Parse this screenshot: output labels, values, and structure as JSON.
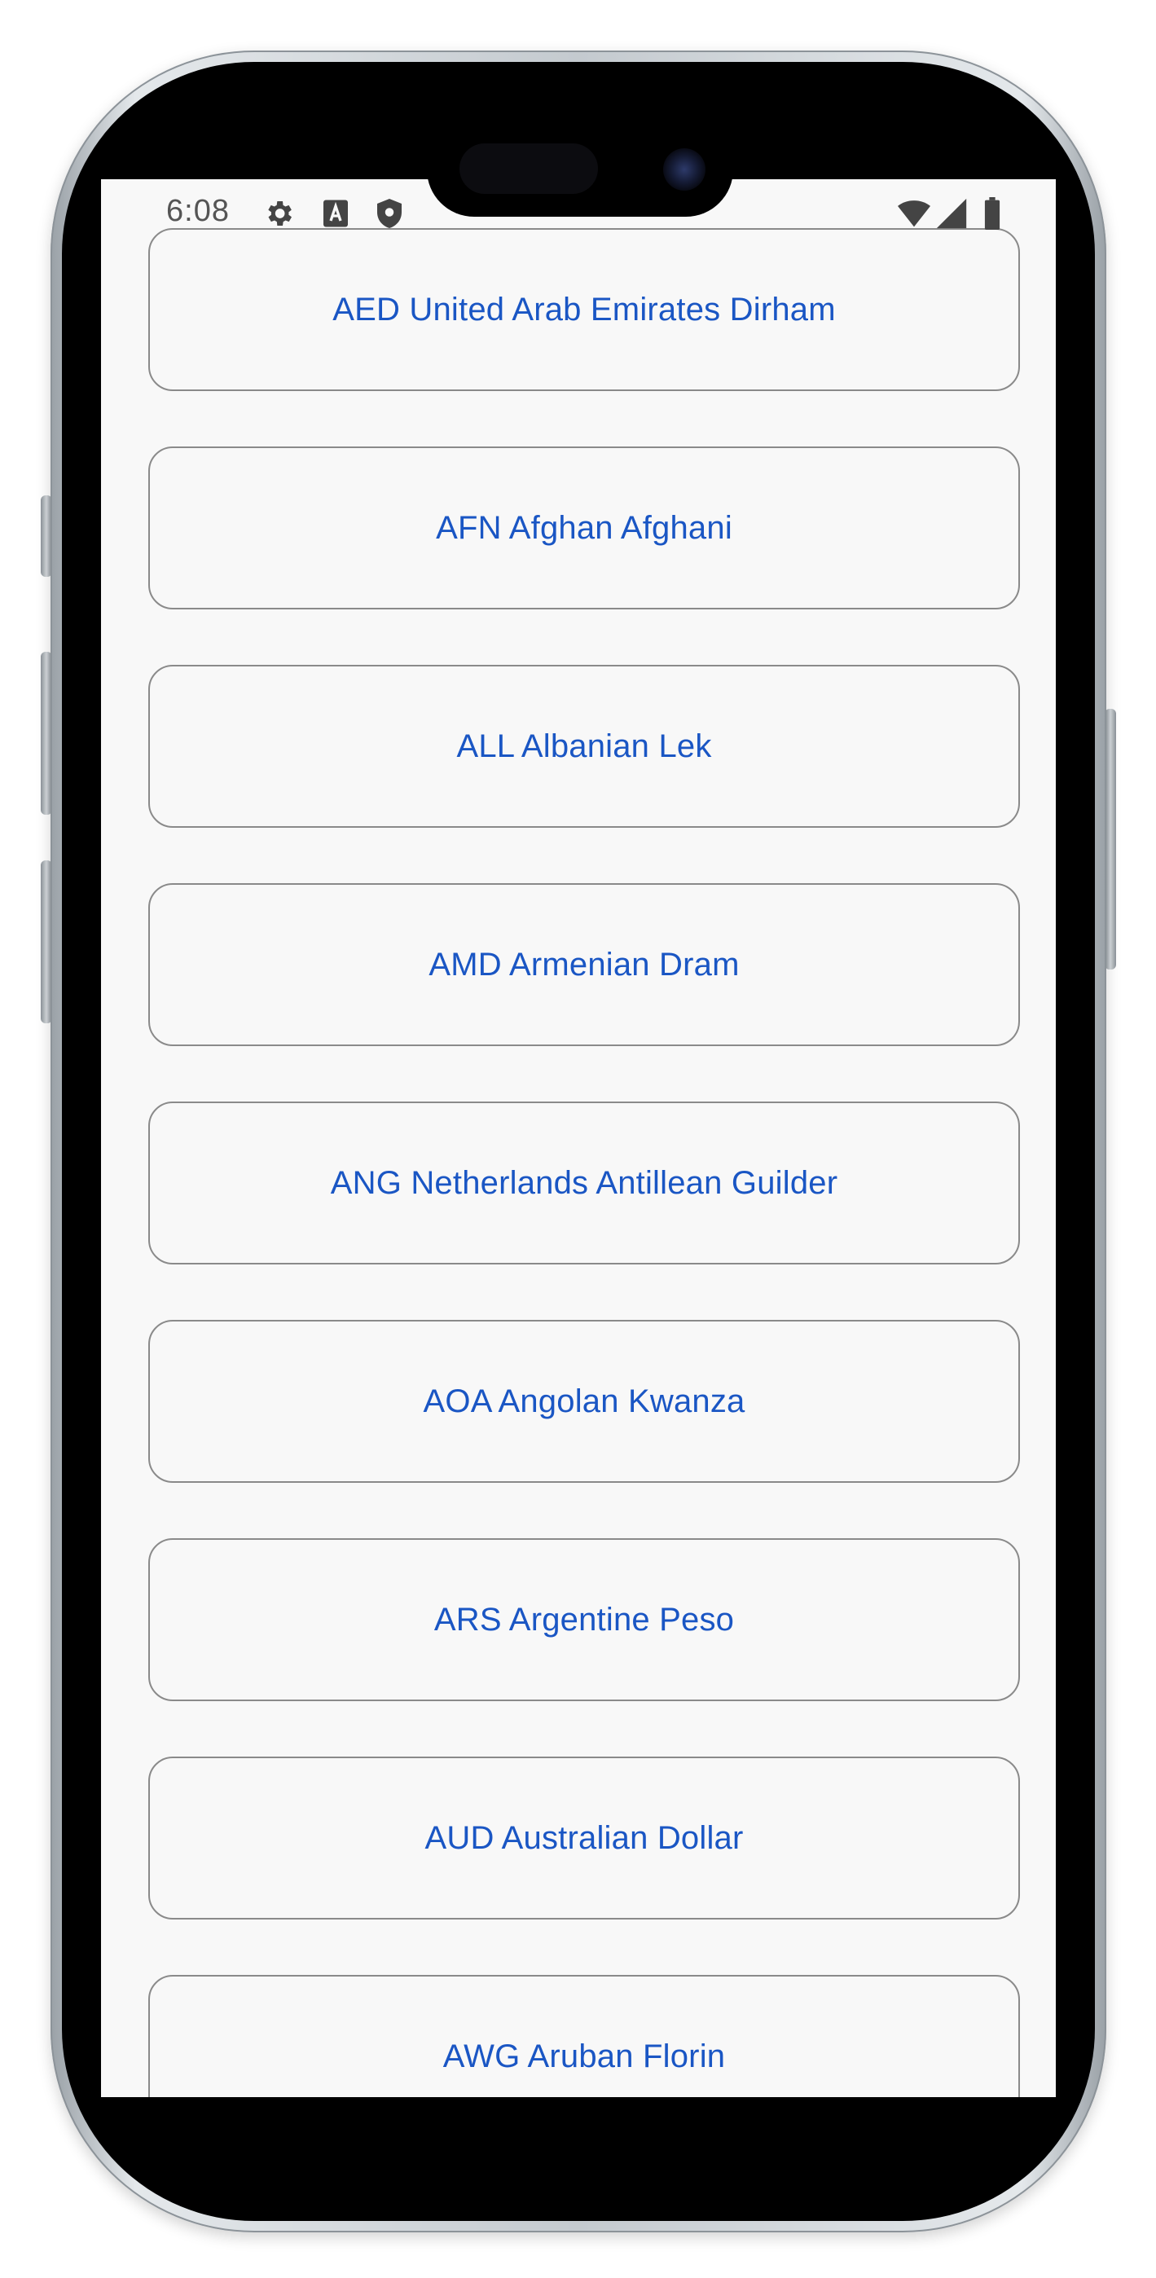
{
  "status_bar": {
    "time": "6:08",
    "left_icons": [
      "gear-icon",
      "a-box-icon",
      "shield-icon"
    ],
    "right_icons": [
      "wifi-icon",
      "signal-icon",
      "battery-icon"
    ]
  },
  "currencies": [
    {
      "label": "AED United Arab Emirates Dirham"
    },
    {
      "label": "AFN Afghan Afghani"
    },
    {
      "label": "ALL Albanian Lek"
    },
    {
      "label": "AMD Armenian Dram"
    },
    {
      "label": "ANG Netherlands Antillean Guilder"
    },
    {
      "label": "AOA Angolan Kwanza"
    },
    {
      "label": "ARS Argentine Peso"
    },
    {
      "label": "AUD Australian Dollar"
    },
    {
      "label": "AWG Aruban Florin"
    }
  ],
  "colors": {
    "label_text": "#1a56c4",
    "item_border": "#8a8a8a",
    "screen_background": "#f8f8f8"
  }
}
